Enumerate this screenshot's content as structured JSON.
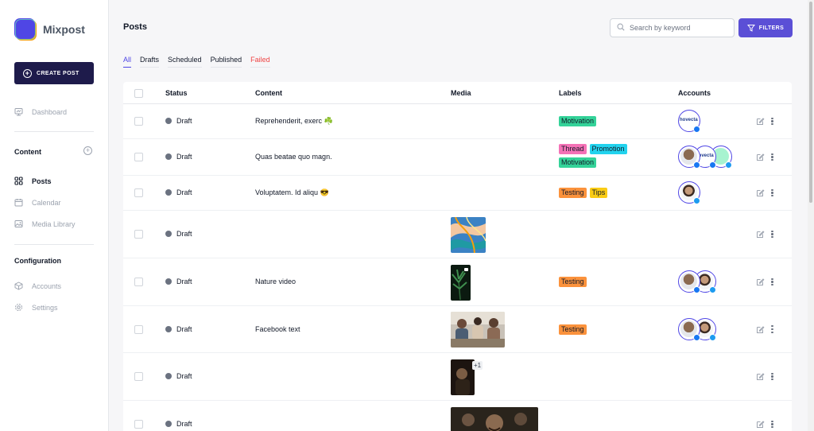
{
  "app": {
    "name": "Mixpost"
  },
  "sidebar": {
    "create_label": "CREATE POST",
    "dashboard": "Dashboard",
    "content_section": "Content",
    "content_items": [
      {
        "label": "Posts",
        "icon": "grid-icon",
        "active": true
      },
      {
        "label": "Calendar",
        "icon": "calendar-icon",
        "active": false
      },
      {
        "label": "Media Library",
        "icon": "image-icon",
        "active": false
      }
    ],
    "config_section": "Configuration",
    "config_items": [
      {
        "label": "Accounts",
        "icon": "cube-icon"
      },
      {
        "label": "Settings",
        "icon": "gear-icon"
      }
    ]
  },
  "header": {
    "title": "Posts",
    "search_placeholder": "Search by keyword",
    "filters_label": "FILTERS"
  },
  "tabs": [
    "All",
    "Drafts",
    "Scheduled",
    "Published",
    "Failed"
  ],
  "table": {
    "columns": [
      "Status",
      "Content",
      "Media",
      "Labels",
      "Accounts"
    ],
    "rows": [
      {
        "status": "Draft",
        "content": "Reprehenderit, exerc ☘️",
        "labels": [
          "Motivation"
        ],
        "accounts": [
          "facebook"
        ],
        "media": null
      },
      {
        "status": "Draft",
        "content": "Quas beatae quo magn.",
        "labels": [
          "Thread",
          "Promotion",
          "Motivation"
        ],
        "accounts": [
          "facebook",
          "facebook",
          "twitter"
        ],
        "media": null
      },
      {
        "status": "Draft",
        "content": "Voluptatem. Id aliqu 😎",
        "labels": [
          "Testing",
          "Tips"
        ],
        "accounts": [
          "twitter"
        ],
        "media": null
      },
      {
        "status": "Draft",
        "content": "",
        "labels": [],
        "accounts": [],
        "media": "marble"
      },
      {
        "status": "Draft",
        "content": "Nature video",
        "labels": [
          "Testing"
        ],
        "accounts": [
          "facebook",
          "twitter"
        ],
        "media": "plant-video"
      },
      {
        "status": "Draft",
        "content": "Facebook text",
        "labels": [
          "Testing"
        ],
        "accounts": [
          "facebook",
          "twitter"
        ],
        "media": "people"
      },
      {
        "status": "Draft",
        "content": "",
        "labels": [],
        "accounts": [],
        "media": "dark-photo",
        "media_more": "+1"
      },
      {
        "status": "Draft",
        "content": "",
        "labels": [],
        "accounts": [],
        "media": "movie-still"
      }
    ]
  },
  "avatar_text": "hovecta",
  "colors": {
    "accent": "#4f46e5",
    "navy": "#1e1b4b",
    "failed": "#ef4444",
    "label_motivation": "#34d399",
    "label_thread": "#f472b6",
    "label_promotion": "#22d3ee",
    "label_testing": "#fb923c",
    "label_tips": "#facc15",
    "facebook": "#1877f2",
    "twitter": "#1d9bf0"
  }
}
